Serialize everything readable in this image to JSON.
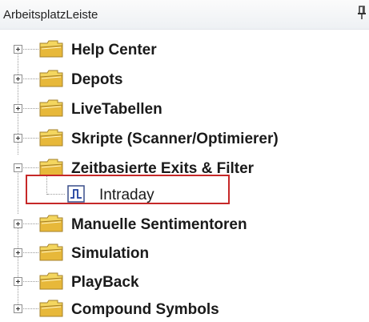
{
  "panel": {
    "title": "ArbeitsplatzLeiste",
    "pin_icon": "pin-icon"
  },
  "tree": {
    "items": [
      {
        "label": "Help Center",
        "expanded": false,
        "icon": "folder-icon"
      },
      {
        "label": "Depots",
        "expanded": false,
        "icon": "folder-icon"
      },
      {
        "label": "LiveTabellen",
        "expanded": false,
        "icon": "folder-icon"
      },
      {
        "label": "Skripte (Scanner/Optimierer)",
        "expanded": false,
        "icon": "folder-icon"
      },
      {
        "label": "Zeitbasierte Exits & Filter",
        "expanded": true,
        "icon": "folder-icon",
        "children": [
          {
            "label": "Intraday",
            "icon": "chart-icon",
            "highlighted": true
          }
        ]
      },
      {
        "label": "Manuelle Sentimentoren",
        "expanded": false,
        "icon": "folder-icon"
      },
      {
        "label": "Simulation",
        "expanded": false,
        "icon": "folder-icon"
      },
      {
        "label": "PlayBack",
        "expanded": false,
        "icon": "folder-icon"
      },
      {
        "label": "Compound Symbols",
        "expanded": false,
        "icon": "folder-icon"
      }
    ]
  },
  "colors": {
    "highlight_border": "#c62828",
    "folder_fill": "#f2d45c",
    "folder_shade": "#c9a227"
  }
}
